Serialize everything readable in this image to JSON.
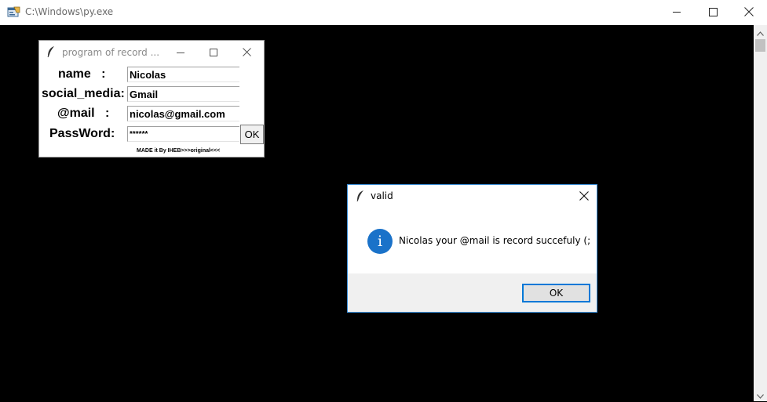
{
  "console": {
    "title": "C:\\Windows\\py.exe",
    "icon": "python-console-icon"
  },
  "record_window": {
    "title": "program of record ...",
    "fields": [
      {
        "label": "name   :",
        "value": "Nicolas"
      },
      {
        "label": "social_media:",
        "value": "Gmail"
      },
      {
        "label": "@mail   :",
        "value": "nicolas@gmail.com"
      },
      {
        "label": "PassWord:",
        "value": "******"
      }
    ],
    "ok_label": "OK",
    "credit": "MADE it By IHEB>>>original<<<"
  },
  "valid_dialog": {
    "title": "valid",
    "icon_glyph": "i",
    "message": "Nicolas your @mail is record succefuly (;",
    "ok_label": "OK"
  },
  "colors": {
    "console_bg": "#000000",
    "dialog_accent": "#0078d7",
    "info_icon": "#1a72c9"
  }
}
